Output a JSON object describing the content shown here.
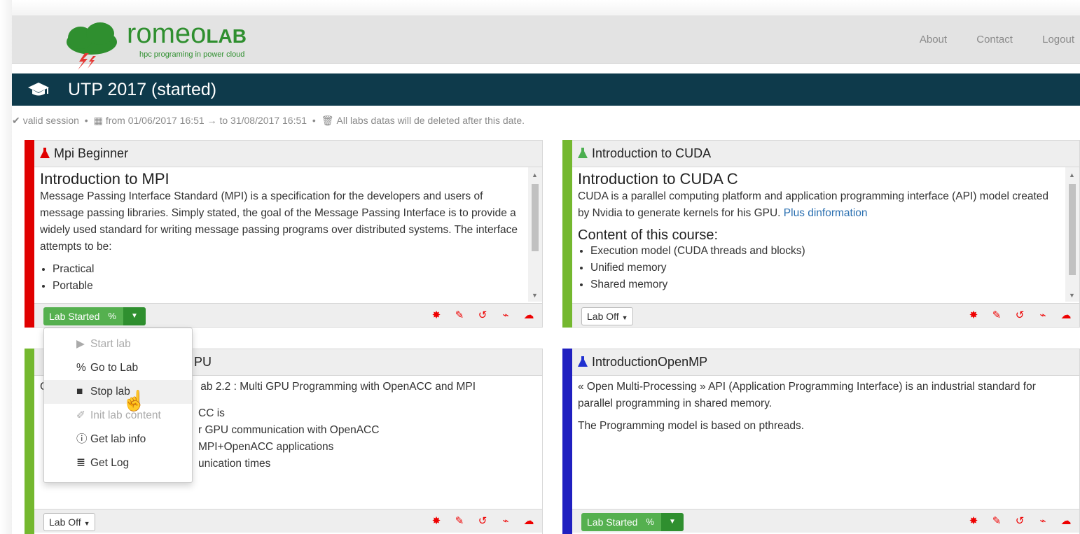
{
  "header": {
    "logo_main": "romeo",
    "logo_bold": "LAB",
    "logo_sub": "hpc programing in power cloud",
    "nav": [
      "About",
      "Contact",
      "Logout"
    ]
  },
  "title": "UTP 2017 (started)",
  "session": {
    "status": "valid session",
    "range": "from 01/06/2017 16:51 → to 31/08/2017 16:51",
    "notice": "All labs datas will de deleted after this date."
  },
  "panels": [
    {
      "title": "Mpi Beginner",
      "stripe_color": "#e00000",
      "flask_color": "#e00000",
      "heading": "Introduction to MPI",
      "text": "Message Passing Interface Standard (MPI) is a specification for the developers and users of message passing libraries. Simply stated, the goal of the Message Passing Interface is to provide a widely used standard for writing message passing programs over distributed systems. The interface attempts to be:",
      "list": [
        "Practical",
        "Portable"
      ],
      "button": "Lab Started"
    },
    {
      "title": "Introduction to CUDA",
      "stripe_color": "#74b82f",
      "flask_color": "#4caf50",
      "heading": "Introduction to CUDA C",
      "text": "CUDA is a parallel computing platform and application programming interface (API) model created by Nvidia to generate kernels for his GPU.",
      "link": "Plus dinformation",
      "subheading": "Content of this course:",
      "list": [
        "Execution model (CUDA threads and blocks)",
        "Unified memory",
        "Shared memory"
      ],
      "button": "Lab Off"
    },
    {
      "title": "PU",
      "stripe_color": "#74b82f",
      "flask_color": "#4caf50",
      "lead": "C",
      "text": "ab 2.2 : Multi GPU Programming with OpenACC and MPI",
      "lines": [
        "CC is",
        "r GPU communication with OpenACC",
        "MPI+OpenACC applications",
        "unication times"
      ],
      "button": "Lab Off"
    },
    {
      "title": "IntroductionOpenMP",
      "stripe_color": "#2020c0",
      "flask_color": "#2030d0",
      "text": "« Open Multi-Processing » API (Application Programming Interface) is an industrial standard for parallel programming in shared memory.",
      "text2": "The Programming model is based on pthreads.",
      "button": "Lab Started"
    }
  ],
  "dropdown": {
    "items": [
      {
        "label": "Start lab",
        "icon": "play-icon",
        "disabled": true
      },
      {
        "label": "Go to Lab",
        "icon": "link-icon",
        "disabled": false
      },
      {
        "label": "Stop lab",
        "icon": "stop-icon",
        "disabled": false
      },
      {
        "label": "Init lab content",
        "icon": "eraser-icon",
        "disabled": true
      },
      {
        "label": "Get lab info",
        "icon": "info-icon",
        "disabled": false
      },
      {
        "label": "Get Log",
        "icon": "database-icon",
        "disabled": false
      }
    ]
  },
  "colors": {
    "accent_green": "#55b04f",
    "title_bg": "#0e3a4b",
    "icon_red": "#e00000"
  }
}
